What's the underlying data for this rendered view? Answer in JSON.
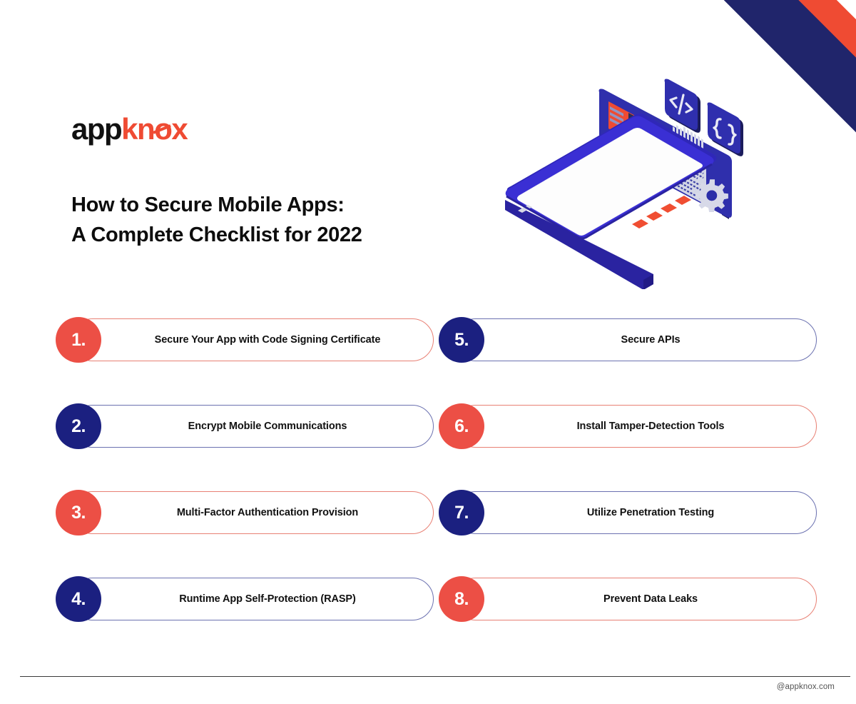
{
  "brand": {
    "logo_prefix": "app",
    "logo_suffix_k": "kn",
    "logo_suffix_o": "o",
    "logo_suffix_x": "x",
    "color_red": "#EF4B33",
    "color_navy": "#20256B",
    "color_badge_red": "#EC4F45",
    "color_badge_blue": "#1B2080"
  },
  "headline": {
    "line1": "How to Secure Mobile Apps:",
    "line2": "A Complete Checklist for 2022"
  },
  "illustration": {
    "name": "isometric-mobile-security-illustration",
    "elements": [
      "smartphone",
      "dashboard-panel",
      "code-tag-panel",
      "curly-brace-panel",
      "gear-icon"
    ]
  },
  "checklist": {
    "left_column": [
      {
        "number": "1.",
        "label": "Secure Your App with Code Signing Certificate",
        "accent": "red"
      },
      {
        "number": "2.",
        "label": "Encrypt Mobile Communications",
        "accent": "blue"
      },
      {
        "number": "3.",
        "label": "Multi-Factor Authentication Provision",
        "accent": "red"
      },
      {
        "number": "4.",
        "label": "Runtime App Self-Protection (RASP)",
        "accent": "blue"
      }
    ],
    "right_column": [
      {
        "number": "5.",
        "label": "Secure APIs",
        "accent": "blue"
      },
      {
        "number": "6.",
        "label": "Install Tamper-Detection Tools",
        "accent": "red"
      },
      {
        "number": "7.",
        "label": "Utilize Penetration Testing",
        "accent": "blue"
      },
      {
        "number": "8.",
        "label": "Prevent Data Leaks",
        "accent": "red"
      }
    ]
  },
  "footer": {
    "handle": "@appknox.com"
  }
}
